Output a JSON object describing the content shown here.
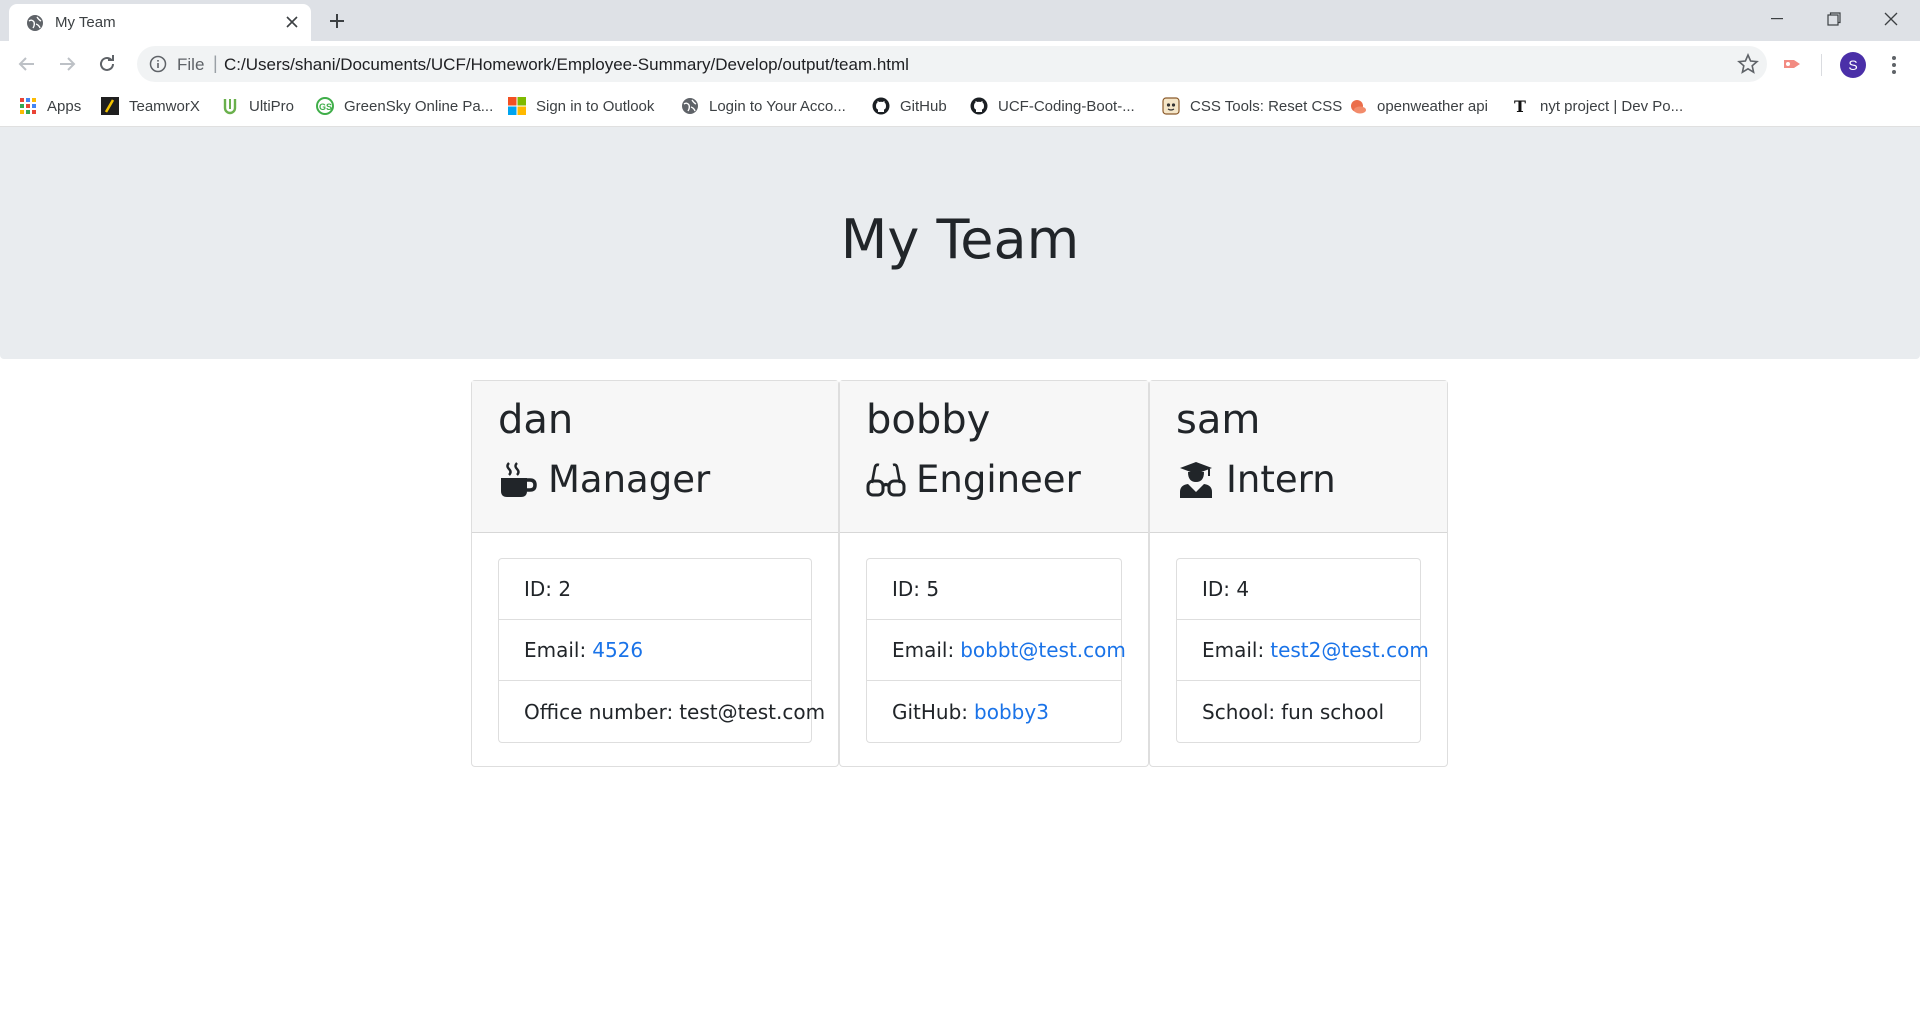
{
  "browser": {
    "tab_title": "My Team",
    "url_scheme": "File",
    "url": "C:/Users/shani/Documents/UCF/Homework/Employee-Summary/Develop/output/team.html",
    "profile_initial": "S",
    "bookmarks": [
      {
        "label": "Apps",
        "icon": "apps-grid-icon"
      },
      {
        "label": "TeamworX",
        "icon": "teamworx-icon"
      },
      {
        "label": "UltiPro",
        "icon": "ultipro-icon"
      },
      {
        "label": "GreenSky Online Pa...",
        "icon": "greensky-icon"
      },
      {
        "label": "Sign in to Outlook",
        "icon": "microsoft-icon"
      },
      {
        "label": "Login to Your Acco...",
        "icon": "globe-icon"
      },
      {
        "label": "GitHub",
        "icon": "github-icon"
      },
      {
        "label": "UCF-Coding-Boot-...",
        "icon": "github-icon"
      },
      {
        "label": "CSS Tools: Reset CSS",
        "icon": "css-tools-icon"
      },
      {
        "label": "openweather api",
        "icon": "openweather-icon"
      },
      {
        "label": "nyt project | Dev Po...",
        "icon": "nyt-icon"
      }
    ]
  },
  "page": {
    "title": "My Team"
  },
  "team": [
    {
      "name": "dan",
      "role": "Manager",
      "role_icon": "coffee-mug-icon",
      "id_label": "ID: 2",
      "email_label": "Email:",
      "email_value": "4526",
      "extra_label": "Office number:",
      "extra_value": "test@test.com",
      "extra_is_link": false
    },
    {
      "name": "bobby",
      "role": "Engineer",
      "role_icon": "glasses-icon",
      "id_label": "ID: 5",
      "email_label": "Email:",
      "email_value": "bobbt@test.com",
      "extra_label": "GitHub:",
      "extra_value": "bobby3",
      "extra_is_link": true
    },
    {
      "name": "sam",
      "role": "Intern",
      "role_icon": "graduate-icon",
      "id_label": "ID: 4",
      "email_label": "Email:",
      "email_value": "test2@test.com",
      "extra_label": "School:",
      "extra_value": "fun school",
      "extra_is_link": false
    }
  ],
  "colors": {
    "link": "#1a73e8",
    "jumbotron": "#e9ecef",
    "card_header": "#f7f7f7",
    "avatar": "#4a2fa8"
  }
}
